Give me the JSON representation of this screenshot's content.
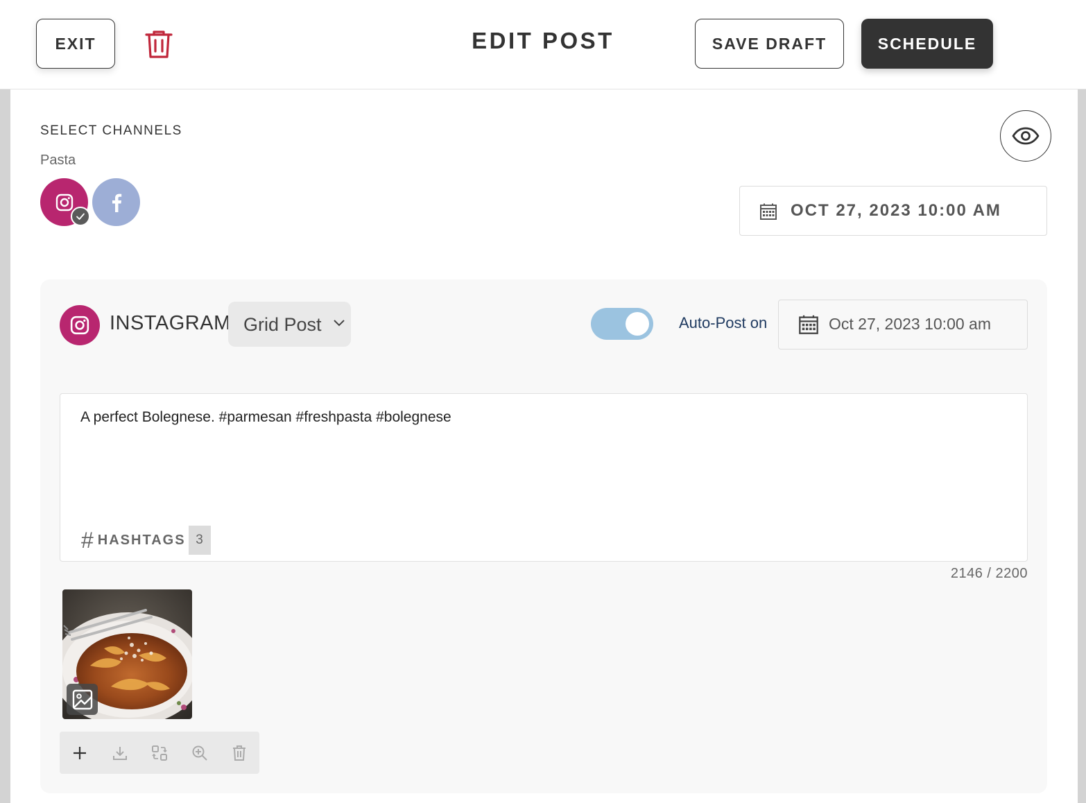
{
  "header": {
    "exit_label": "EXIT",
    "title": "EDIT POST",
    "save_draft_label": "SAVE DRAFT",
    "schedule_label": "SCHEDULE",
    "delete_icon": "trash-icon"
  },
  "channels": {
    "section_label": "SELECT CHANNELS",
    "group_name": "Pasta",
    "items": [
      {
        "name": "instagram",
        "icon": "instagram-icon",
        "selected": true,
        "color": "#b8266f"
      },
      {
        "name": "facebook",
        "icon": "facebook-icon",
        "selected": false,
        "color": "#9daed6"
      }
    ]
  },
  "schedule": {
    "datetime": "OCT 27, 2023 10:00 AM"
  },
  "instagram_panel": {
    "network_label": "INSTAGRAM",
    "post_type": "Grid Post",
    "auto_post_enabled": true,
    "auto_post_label": "Auto-Post on",
    "auto_post_datetime": "Oct 27, 2023 10:00 am",
    "caption": "A perfect Bolegnese. #parmesan #freshpasta #bolegnese",
    "hashtags_label": "HASHTAGS",
    "hashtags_count": "3",
    "char_count": "2146 / 2200",
    "media_toolbar": [
      "plus-icon",
      "download-icon",
      "swap-icon",
      "zoom-in-icon",
      "trash-icon"
    ]
  },
  "colors": {
    "instagram": "#b8266f",
    "facebook": "#9daed6",
    "toggle_on": "#9bc3e0",
    "delete": "#c0263a",
    "primary_button": "#333333"
  }
}
